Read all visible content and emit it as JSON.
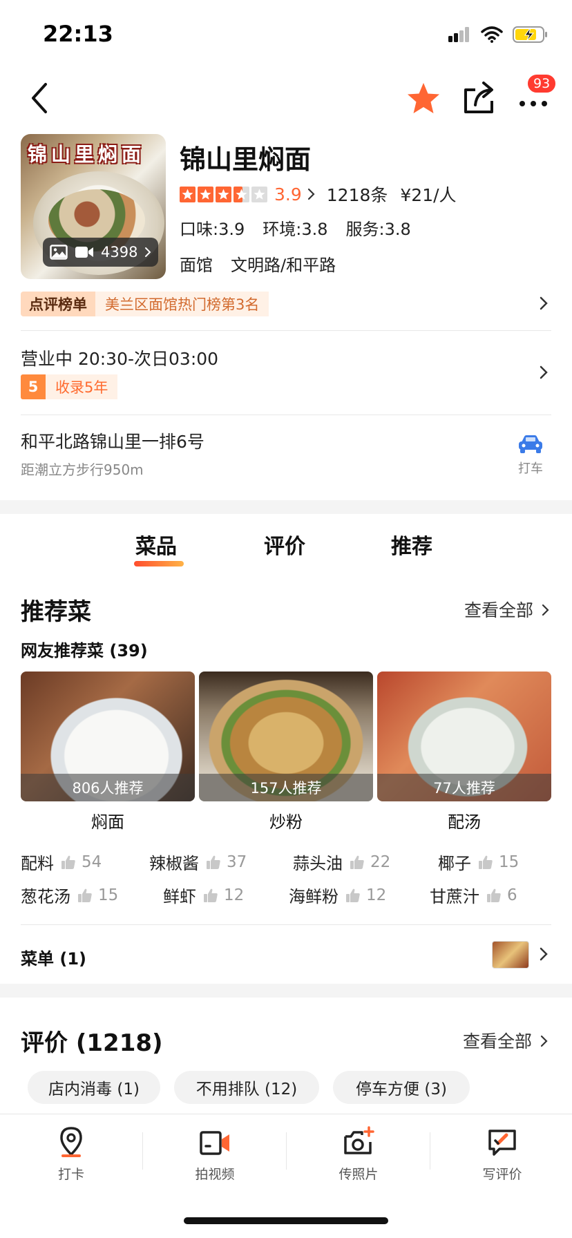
{
  "status_bar": {
    "time": "22:13"
  },
  "nav": {
    "badge_count": "93"
  },
  "shop": {
    "photo_title": "锦山里焖面",
    "media_count": "4398",
    "name": "锦山里焖面",
    "score": "3.9",
    "review_count": "1218条",
    "price": "¥21/人",
    "taste": "口味:3.9",
    "environment": "环境:3.8",
    "service": "服务:3.8",
    "category": "面馆",
    "area": "文明路/和平路",
    "rank_tag": "点评榜单",
    "rank_text": "美兰区面馆热门榜第3名",
    "hours": "营业中 20:30-次日03:00",
    "years_num": "5",
    "years_text": "收录5年",
    "address": "和平北路锦山里一排6号",
    "distance": "距潮立方步行950m",
    "taxi_label": "打车"
  },
  "tabs": [
    "菜品",
    "评价",
    "推荐"
  ],
  "recommend": {
    "title": "推荐菜",
    "see_all": "查看全部",
    "subhead": "网友推荐菜 (39)",
    "dishes": [
      {
        "name": "焖面",
        "count": "806人推荐"
      },
      {
        "name": "炒粉",
        "count": "157人推荐"
      },
      {
        "name": "配汤",
        "count": "77人推荐"
      }
    ],
    "tags": [
      {
        "name": "配料",
        "count": "54"
      },
      {
        "name": "辣椒酱",
        "count": "37"
      },
      {
        "name": "蒜头油",
        "count": "22"
      },
      {
        "name": "椰子",
        "count": "15"
      },
      {
        "name": "葱花汤",
        "count": "15"
      },
      {
        "name": "鲜虾",
        "count": "12"
      },
      {
        "name": "海鲜粉",
        "count": "12"
      },
      {
        "name": "甘蔗汁",
        "count": "6"
      }
    ],
    "menu_label": "菜单 (1)"
  },
  "reviews": {
    "title": "评价 (1218)",
    "see_all": "查看全部",
    "chips": [
      "店内消毒 (1)",
      "不用排队 (12)",
      "停车方便 (3)"
    ]
  },
  "bottom_bar": {
    "items": [
      {
        "label": "打卡",
        "icon": "location-pin-icon"
      },
      {
        "label": "拍视频",
        "icon": "video-camera-icon"
      },
      {
        "label": "传照片",
        "icon": "add-photo-icon"
      },
      {
        "label": "写评价",
        "icon": "write-review-icon"
      }
    ]
  },
  "colors": {
    "accent": "#ff6633",
    "star": "#ff6633",
    "badge": "#ff3b30",
    "taxi": "#3b7be8"
  }
}
